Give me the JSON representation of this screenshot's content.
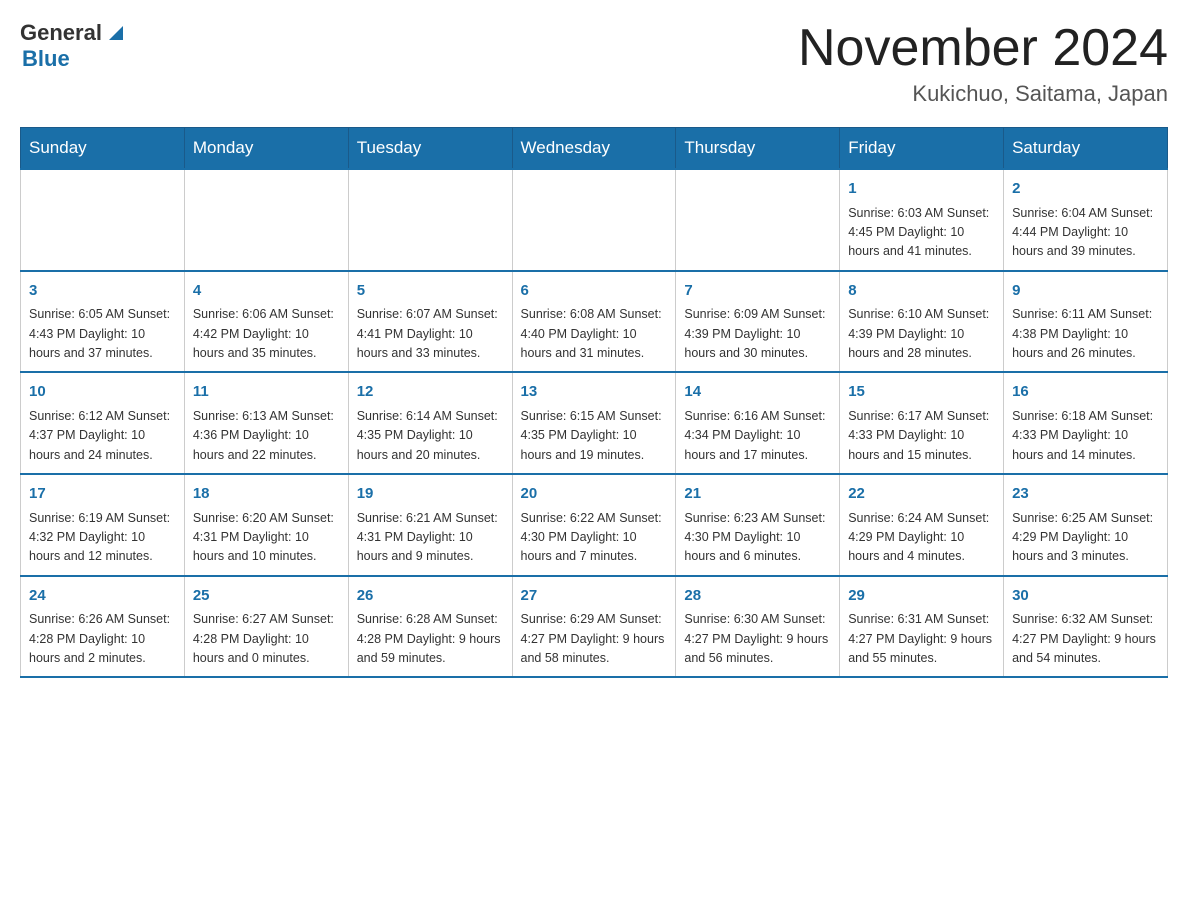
{
  "header": {
    "logo": {
      "general": "General",
      "blue": "Blue",
      "triangle": "▶"
    },
    "title": "November 2024",
    "location": "Kukichuo, Saitama, Japan"
  },
  "days_of_week": [
    "Sunday",
    "Monday",
    "Tuesday",
    "Wednesday",
    "Thursday",
    "Friday",
    "Saturday"
  ],
  "weeks": [
    [
      {
        "day": "",
        "info": ""
      },
      {
        "day": "",
        "info": ""
      },
      {
        "day": "",
        "info": ""
      },
      {
        "day": "",
        "info": ""
      },
      {
        "day": "",
        "info": ""
      },
      {
        "day": "1",
        "info": "Sunrise: 6:03 AM\nSunset: 4:45 PM\nDaylight: 10 hours and 41 minutes."
      },
      {
        "day": "2",
        "info": "Sunrise: 6:04 AM\nSunset: 4:44 PM\nDaylight: 10 hours and 39 minutes."
      }
    ],
    [
      {
        "day": "3",
        "info": "Sunrise: 6:05 AM\nSunset: 4:43 PM\nDaylight: 10 hours and 37 minutes."
      },
      {
        "day": "4",
        "info": "Sunrise: 6:06 AM\nSunset: 4:42 PM\nDaylight: 10 hours and 35 minutes."
      },
      {
        "day": "5",
        "info": "Sunrise: 6:07 AM\nSunset: 4:41 PM\nDaylight: 10 hours and 33 minutes."
      },
      {
        "day": "6",
        "info": "Sunrise: 6:08 AM\nSunset: 4:40 PM\nDaylight: 10 hours and 31 minutes."
      },
      {
        "day": "7",
        "info": "Sunrise: 6:09 AM\nSunset: 4:39 PM\nDaylight: 10 hours and 30 minutes."
      },
      {
        "day": "8",
        "info": "Sunrise: 6:10 AM\nSunset: 4:39 PM\nDaylight: 10 hours and 28 minutes."
      },
      {
        "day": "9",
        "info": "Sunrise: 6:11 AM\nSunset: 4:38 PM\nDaylight: 10 hours and 26 minutes."
      }
    ],
    [
      {
        "day": "10",
        "info": "Sunrise: 6:12 AM\nSunset: 4:37 PM\nDaylight: 10 hours and 24 minutes."
      },
      {
        "day": "11",
        "info": "Sunrise: 6:13 AM\nSunset: 4:36 PM\nDaylight: 10 hours and 22 minutes."
      },
      {
        "day": "12",
        "info": "Sunrise: 6:14 AM\nSunset: 4:35 PM\nDaylight: 10 hours and 20 minutes."
      },
      {
        "day": "13",
        "info": "Sunrise: 6:15 AM\nSunset: 4:35 PM\nDaylight: 10 hours and 19 minutes."
      },
      {
        "day": "14",
        "info": "Sunrise: 6:16 AM\nSunset: 4:34 PM\nDaylight: 10 hours and 17 minutes."
      },
      {
        "day": "15",
        "info": "Sunrise: 6:17 AM\nSunset: 4:33 PM\nDaylight: 10 hours and 15 minutes."
      },
      {
        "day": "16",
        "info": "Sunrise: 6:18 AM\nSunset: 4:33 PM\nDaylight: 10 hours and 14 minutes."
      }
    ],
    [
      {
        "day": "17",
        "info": "Sunrise: 6:19 AM\nSunset: 4:32 PM\nDaylight: 10 hours and 12 minutes."
      },
      {
        "day": "18",
        "info": "Sunrise: 6:20 AM\nSunset: 4:31 PM\nDaylight: 10 hours and 10 minutes."
      },
      {
        "day": "19",
        "info": "Sunrise: 6:21 AM\nSunset: 4:31 PM\nDaylight: 10 hours and 9 minutes."
      },
      {
        "day": "20",
        "info": "Sunrise: 6:22 AM\nSunset: 4:30 PM\nDaylight: 10 hours and 7 minutes."
      },
      {
        "day": "21",
        "info": "Sunrise: 6:23 AM\nSunset: 4:30 PM\nDaylight: 10 hours and 6 minutes."
      },
      {
        "day": "22",
        "info": "Sunrise: 6:24 AM\nSunset: 4:29 PM\nDaylight: 10 hours and 4 minutes."
      },
      {
        "day": "23",
        "info": "Sunrise: 6:25 AM\nSunset: 4:29 PM\nDaylight: 10 hours and 3 minutes."
      }
    ],
    [
      {
        "day": "24",
        "info": "Sunrise: 6:26 AM\nSunset: 4:28 PM\nDaylight: 10 hours and 2 minutes."
      },
      {
        "day": "25",
        "info": "Sunrise: 6:27 AM\nSunset: 4:28 PM\nDaylight: 10 hours and 0 minutes."
      },
      {
        "day": "26",
        "info": "Sunrise: 6:28 AM\nSunset: 4:28 PM\nDaylight: 9 hours and 59 minutes."
      },
      {
        "day": "27",
        "info": "Sunrise: 6:29 AM\nSunset: 4:27 PM\nDaylight: 9 hours and 58 minutes."
      },
      {
        "day": "28",
        "info": "Sunrise: 6:30 AM\nSunset: 4:27 PM\nDaylight: 9 hours and 56 minutes."
      },
      {
        "day": "29",
        "info": "Sunrise: 6:31 AM\nSunset: 4:27 PM\nDaylight: 9 hours and 55 minutes."
      },
      {
        "day": "30",
        "info": "Sunrise: 6:32 AM\nSunset: 4:27 PM\nDaylight: 9 hours and 54 minutes."
      }
    ]
  ]
}
